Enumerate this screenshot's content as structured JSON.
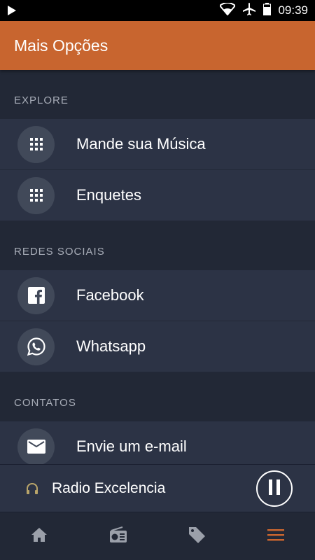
{
  "status_bar": {
    "time": "09:39"
  },
  "header": {
    "title": "Mais Opções"
  },
  "sections": [
    {
      "title": "EXPLORE",
      "items": [
        {
          "label": "Mande sua Música",
          "icon": "grid-icon"
        },
        {
          "label": "Enquetes",
          "icon": "grid-icon"
        }
      ]
    },
    {
      "title": "REDES SOCIAIS",
      "items": [
        {
          "label": "Facebook",
          "icon": "facebook-icon"
        },
        {
          "label": "Whatsapp",
          "icon": "whatsapp-icon"
        }
      ]
    },
    {
      "title": "CONTATOS",
      "items": [
        {
          "label": "Envie um e-mail",
          "icon": "mail-icon"
        }
      ]
    }
  ],
  "player": {
    "station": "Radio Excelencia",
    "state": "playing"
  },
  "bottom_nav": [
    {
      "icon": "home-icon",
      "active": false
    },
    {
      "icon": "radio-icon",
      "active": false
    },
    {
      "icon": "tag-icon",
      "active": false
    },
    {
      "icon": "menu-icon",
      "active": true
    }
  ],
  "colors": {
    "header": "#c8652f",
    "accent": "#c8652f",
    "background": "#222836",
    "row": "#2c3345",
    "icon_circle": "#414959",
    "section_text": "#a8adb8",
    "nav_icon": "#9ba0aa"
  }
}
